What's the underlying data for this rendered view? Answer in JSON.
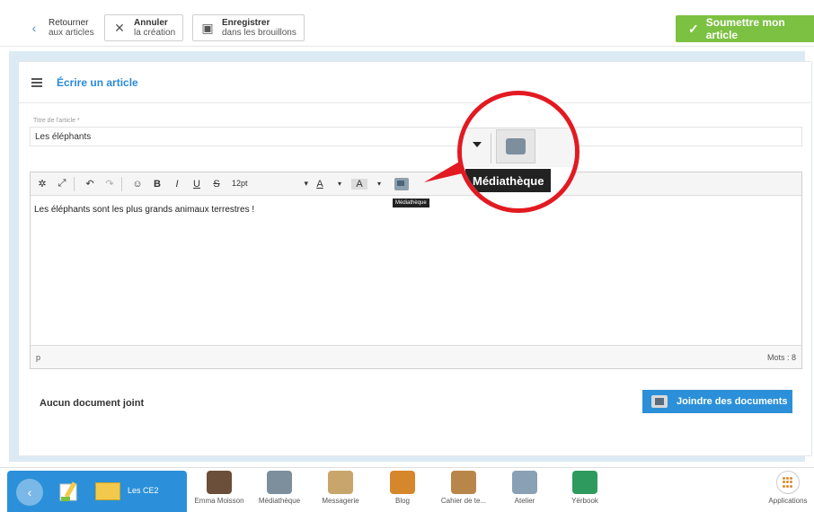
{
  "toolbar": {
    "back": {
      "line1": "Retourner",
      "line2": "aux articles"
    },
    "cancel": {
      "line1": "Annuler",
      "line2": "la création"
    },
    "save": {
      "line1": "Enregistrer",
      "line2": "dans les brouillons"
    },
    "submit": "Soumettre mon article"
  },
  "article": {
    "header_title": "Écrire un article",
    "title_label": "Titre de l'article *",
    "title_value": "Les éléphants"
  },
  "editor": {
    "font_size": "12pt",
    "content": "Les éléphants sont les plus grands animaux terrestres !",
    "status_element": "p",
    "word_count": "Mots : 8",
    "tooltip": "Médiathèque"
  },
  "callout": {
    "tooltip": "Médiathèque"
  },
  "attachments": {
    "empty_label": "Aucun document joint",
    "join_button": "Joindre des documents"
  },
  "dock": {
    "class_name": "Les CE2",
    "apps": [
      {
        "label": "Emma Moisson",
        "color": "#6b4f3a"
      },
      {
        "label": "Médiathèque",
        "color": "#7d8f9c"
      },
      {
        "label": "Messagerie",
        "color": "#c8a56a"
      },
      {
        "label": "Blog",
        "color": "#d6862b"
      },
      {
        "label": "Cahier de te...",
        "color": "#b9864a"
      },
      {
        "label": "Atelier",
        "color": "#8aa0b4"
      },
      {
        "label": "Yërbook",
        "color": "#2f9a5e"
      }
    ],
    "applications_label": "Applications"
  },
  "colors": {
    "accent_blue": "#2b90d9",
    "submit_green": "#7cc142",
    "callout_red": "#e21a22"
  }
}
